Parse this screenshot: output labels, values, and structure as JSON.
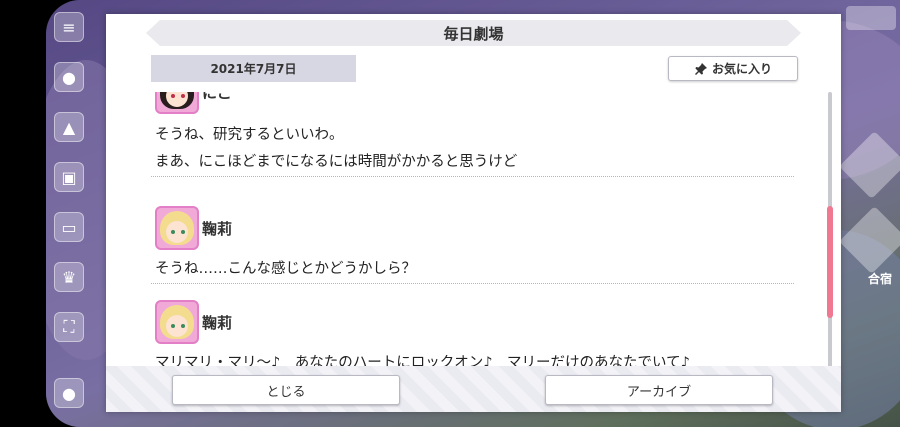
{
  "modal": {
    "title": "毎日劇場",
    "date": "2021年7月7日",
    "favorite_label": "お気に入り"
  },
  "entries": [
    {
      "speaker": "にこ",
      "lines": [
        "そうね、研究するといいわ。",
        "まあ、にこほどまでになるには時間がかかると思うけど"
      ]
    },
    {
      "speaker": "鞠莉",
      "lines": [
        "そうね……こんな感じとかどうかしら？"
      ]
    },
    {
      "speaker": "鞠莉",
      "lines": [
        "マリマリ・マリ〜♪　あなたのハートにロックオン♪　マリーだけのあなたでいて♪"
      ]
    }
  ],
  "buttons": {
    "close": "とじる",
    "archive": "アーカイブ"
  },
  "background": {
    "right_label": "合宿"
  },
  "colors": {
    "scroll_thumb": "#f07891",
    "avatar_frame": "#e27fc6",
    "date_box": "#d6d7e2"
  }
}
